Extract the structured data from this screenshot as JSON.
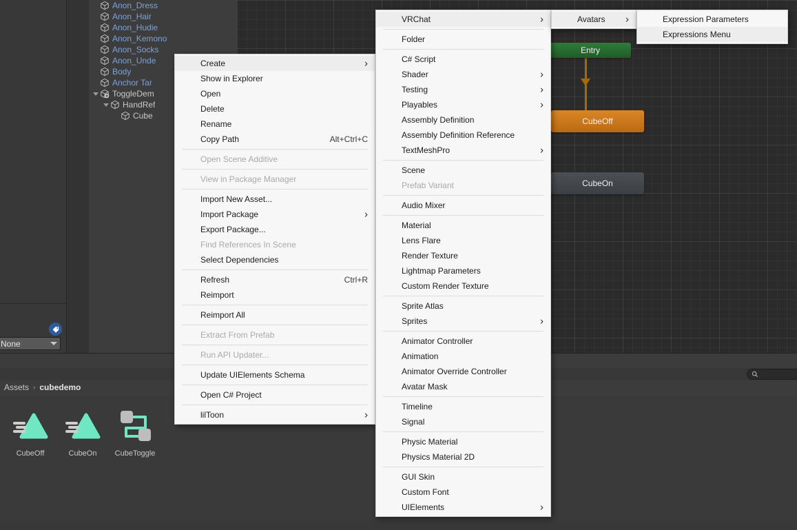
{
  "hierarchy": {
    "items": [
      {
        "label": "Anon_Dress",
        "indent": 0,
        "foldout": false,
        "style": "asset",
        "prefab": false
      },
      {
        "label": "Anon_Hair",
        "indent": 0,
        "foldout": false,
        "style": "asset",
        "prefab": false
      },
      {
        "label": "Anon_Hudie",
        "indent": 0,
        "foldout": false,
        "style": "asset",
        "prefab": false
      },
      {
        "label": "Anon_Kemono",
        "indent": 0,
        "foldout": false,
        "style": "asset",
        "prefab": false
      },
      {
        "label": "Anon_Socks",
        "indent": 0,
        "foldout": false,
        "style": "asset",
        "prefab": false
      },
      {
        "label": "Anon_Unde",
        "indent": 0,
        "foldout": false,
        "style": "asset",
        "prefab": false
      },
      {
        "label": "Body",
        "indent": 0,
        "foldout": false,
        "style": "asset",
        "prefab": false
      },
      {
        "label": "Anchor Tar",
        "indent": 0,
        "foldout": false,
        "style": "asset",
        "prefab": false
      },
      {
        "label": "ToggleDem",
        "indent": 0,
        "foldout": true,
        "style": "plain",
        "prefab": true
      },
      {
        "label": "HandRef",
        "indent": 1,
        "foldout": true,
        "style": "plain",
        "prefab": false
      },
      {
        "label": "Cube",
        "indent": 2,
        "foldout": false,
        "style": "plain",
        "prefab": false
      }
    ]
  },
  "inspector": {
    "tag_icon": "label-icon",
    "dropdown_value": "None"
  },
  "animator": {
    "nodes": [
      {
        "name": "Entry",
        "kind": "entry"
      },
      {
        "name": "CubeOff",
        "kind": "default-state"
      },
      {
        "name": "CubeOn",
        "kind": "state"
      }
    ],
    "colors": {
      "entry": "#2f7c3a",
      "default_state": "#d98626",
      "state": "#4c4f53",
      "transition": "#a5690a"
    }
  },
  "project": {
    "search_placeholder": "",
    "search_value": "",
    "breadcrumb": {
      "root": "Assets",
      "separator": "›",
      "current": "cubedemo"
    },
    "assets": [
      {
        "label": "CubeOff",
        "icon": "animation-clip-icon"
      },
      {
        "label": "CubeOn",
        "icon": "animation-clip-icon"
      },
      {
        "label": "CubeToggle",
        "icon": "animator-controller-icon"
      }
    ]
  },
  "status_bar": {
    "text": ""
  },
  "menus": {
    "asset": {
      "name": "Assets context menu",
      "items": [
        {
          "label": "Create",
          "submenu": true,
          "disabled": false,
          "highlighted": true,
          "shortcut": ""
        },
        {
          "label": "Show in Explorer",
          "submenu": false,
          "disabled": false,
          "highlighted": false,
          "shortcut": ""
        },
        {
          "label": "Open",
          "submenu": false,
          "disabled": false,
          "highlighted": false,
          "shortcut": ""
        },
        {
          "label": "Delete",
          "submenu": false,
          "disabled": false,
          "highlighted": false,
          "shortcut": ""
        },
        {
          "label": "Rename",
          "submenu": false,
          "disabled": false,
          "highlighted": false,
          "shortcut": ""
        },
        {
          "label": "Copy Path",
          "submenu": false,
          "disabled": false,
          "highlighted": false,
          "shortcut": "Alt+Ctrl+C"
        },
        {
          "separator": true
        },
        {
          "label": "Open Scene Additive",
          "submenu": false,
          "disabled": true,
          "highlighted": false,
          "shortcut": ""
        },
        {
          "separator": true
        },
        {
          "label": "View in Package Manager",
          "submenu": false,
          "disabled": true,
          "highlighted": false,
          "shortcut": ""
        },
        {
          "separator": true
        },
        {
          "label": "Import New Asset...",
          "submenu": false,
          "disabled": false,
          "highlighted": false,
          "shortcut": ""
        },
        {
          "label": "Import Package",
          "submenu": true,
          "disabled": false,
          "highlighted": false,
          "shortcut": ""
        },
        {
          "label": "Export Package...",
          "submenu": false,
          "disabled": false,
          "highlighted": false,
          "shortcut": ""
        },
        {
          "label": "Find References In Scene",
          "submenu": false,
          "disabled": true,
          "highlighted": false,
          "shortcut": ""
        },
        {
          "label": "Select Dependencies",
          "submenu": false,
          "disabled": false,
          "highlighted": false,
          "shortcut": ""
        },
        {
          "separator": true
        },
        {
          "label": "Refresh",
          "submenu": false,
          "disabled": false,
          "highlighted": false,
          "shortcut": "Ctrl+R"
        },
        {
          "label": "Reimport",
          "submenu": false,
          "disabled": false,
          "highlighted": false,
          "shortcut": ""
        },
        {
          "separator": true
        },
        {
          "label": "Reimport All",
          "submenu": false,
          "disabled": false,
          "highlighted": false,
          "shortcut": ""
        },
        {
          "separator": true
        },
        {
          "label": "Extract From Prefab",
          "submenu": false,
          "disabled": true,
          "highlighted": false,
          "shortcut": ""
        },
        {
          "separator": true
        },
        {
          "label": "Run API Updater...",
          "submenu": false,
          "disabled": true,
          "highlighted": false,
          "shortcut": ""
        },
        {
          "separator": true
        },
        {
          "label": "Update UIElements Schema",
          "submenu": false,
          "disabled": false,
          "highlighted": false,
          "shortcut": ""
        },
        {
          "separator": true
        },
        {
          "label": "Open C# Project",
          "submenu": false,
          "disabled": false,
          "highlighted": false,
          "shortcut": ""
        },
        {
          "separator": true
        },
        {
          "label": "lilToon",
          "submenu": true,
          "disabled": false,
          "highlighted": false,
          "shortcut": ""
        }
      ]
    },
    "create": {
      "name": "Create submenu",
      "items": [
        {
          "label": "VRChat",
          "submenu": true,
          "disabled": false,
          "highlighted": true,
          "shortcut": ""
        },
        {
          "separator": true
        },
        {
          "label": "Folder",
          "submenu": false,
          "disabled": false,
          "highlighted": false,
          "shortcut": ""
        },
        {
          "separator": true
        },
        {
          "label": "C# Script",
          "submenu": false,
          "disabled": false,
          "highlighted": false,
          "shortcut": ""
        },
        {
          "label": "Shader",
          "submenu": true,
          "disabled": false,
          "highlighted": false,
          "shortcut": ""
        },
        {
          "label": "Testing",
          "submenu": true,
          "disabled": false,
          "highlighted": false,
          "shortcut": ""
        },
        {
          "label": "Playables",
          "submenu": true,
          "disabled": false,
          "highlighted": false,
          "shortcut": ""
        },
        {
          "label": "Assembly Definition",
          "submenu": false,
          "disabled": false,
          "highlighted": false,
          "shortcut": ""
        },
        {
          "label": "Assembly Definition Reference",
          "submenu": false,
          "disabled": false,
          "highlighted": false,
          "shortcut": ""
        },
        {
          "label": "TextMeshPro",
          "submenu": true,
          "disabled": false,
          "highlighted": false,
          "shortcut": ""
        },
        {
          "separator": true
        },
        {
          "label": "Scene",
          "submenu": false,
          "disabled": false,
          "highlighted": false,
          "shortcut": ""
        },
        {
          "label": "Prefab Variant",
          "submenu": false,
          "disabled": true,
          "highlighted": false,
          "shortcut": ""
        },
        {
          "separator": true
        },
        {
          "label": "Audio Mixer",
          "submenu": false,
          "disabled": false,
          "highlighted": false,
          "shortcut": ""
        },
        {
          "separator": true
        },
        {
          "label": "Material",
          "submenu": false,
          "disabled": false,
          "highlighted": false,
          "shortcut": ""
        },
        {
          "label": "Lens Flare",
          "submenu": false,
          "disabled": false,
          "highlighted": false,
          "shortcut": ""
        },
        {
          "label": "Render Texture",
          "submenu": false,
          "disabled": false,
          "highlighted": false,
          "shortcut": ""
        },
        {
          "label": "Lightmap Parameters",
          "submenu": false,
          "disabled": false,
          "highlighted": false,
          "shortcut": ""
        },
        {
          "label": "Custom Render Texture",
          "submenu": false,
          "disabled": false,
          "highlighted": false,
          "shortcut": ""
        },
        {
          "separator": true
        },
        {
          "label": "Sprite Atlas",
          "submenu": false,
          "disabled": false,
          "highlighted": false,
          "shortcut": ""
        },
        {
          "label": "Sprites",
          "submenu": true,
          "disabled": false,
          "highlighted": false,
          "shortcut": ""
        },
        {
          "separator": true
        },
        {
          "label": "Animator Controller",
          "submenu": false,
          "disabled": false,
          "highlighted": false,
          "shortcut": ""
        },
        {
          "label": "Animation",
          "submenu": false,
          "disabled": false,
          "highlighted": false,
          "shortcut": ""
        },
        {
          "label": "Animator Override Controller",
          "submenu": false,
          "disabled": false,
          "highlighted": false,
          "shortcut": ""
        },
        {
          "label": "Avatar Mask",
          "submenu": false,
          "disabled": false,
          "highlighted": false,
          "shortcut": ""
        },
        {
          "separator": true
        },
        {
          "label": "Timeline",
          "submenu": false,
          "disabled": false,
          "highlighted": false,
          "shortcut": ""
        },
        {
          "label": "Signal",
          "submenu": false,
          "disabled": false,
          "highlighted": false,
          "shortcut": ""
        },
        {
          "separator": true
        },
        {
          "label": "Physic Material",
          "submenu": false,
          "disabled": false,
          "highlighted": false,
          "shortcut": ""
        },
        {
          "label": "Physics Material 2D",
          "submenu": false,
          "disabled": false,
          "highlighted": false,
          "shortcut": ""
        },
        {
          "separator": true
        },
        {
          "label": "GUI Skin",
          "submenu": false,
          "disabled": false,
          "highlighted": false,
          "shortcut": ""
        },
        {
          "label": "Custom Font",
          "submenu": false,
          "disabled": false,
          "highlighted": false,
          "shortcut": ""
        },
        {
          "label": "UIElements",
          "submenu": true,
          "disabled": false,
          "highlighted": false,
          "shortcut": ""
        }
      ]
    },
    "vrchat": {
      "name": "VRChat submenu",
      "items": [
        {
          "label": "Avatars",
          "submenu": true,
          "disabled": false,
          "highlighted": true,
          "shortcut": ""
        }
      ]
    },
    "avatars": {
      "name": "Avatars submenu",
      "items": [
        {
          "label": "Expression Parameters",
          "submenu": false,
          "disabled": false,
          "highlighted": false,
          "shortcut": ""
        },
        {
          "label": "Expressions Menu",
          "submenu": false,
          "disabled": false,
          "highlighted": true,
          "shortcut": ""
        }
      ]
    }
  }
}
